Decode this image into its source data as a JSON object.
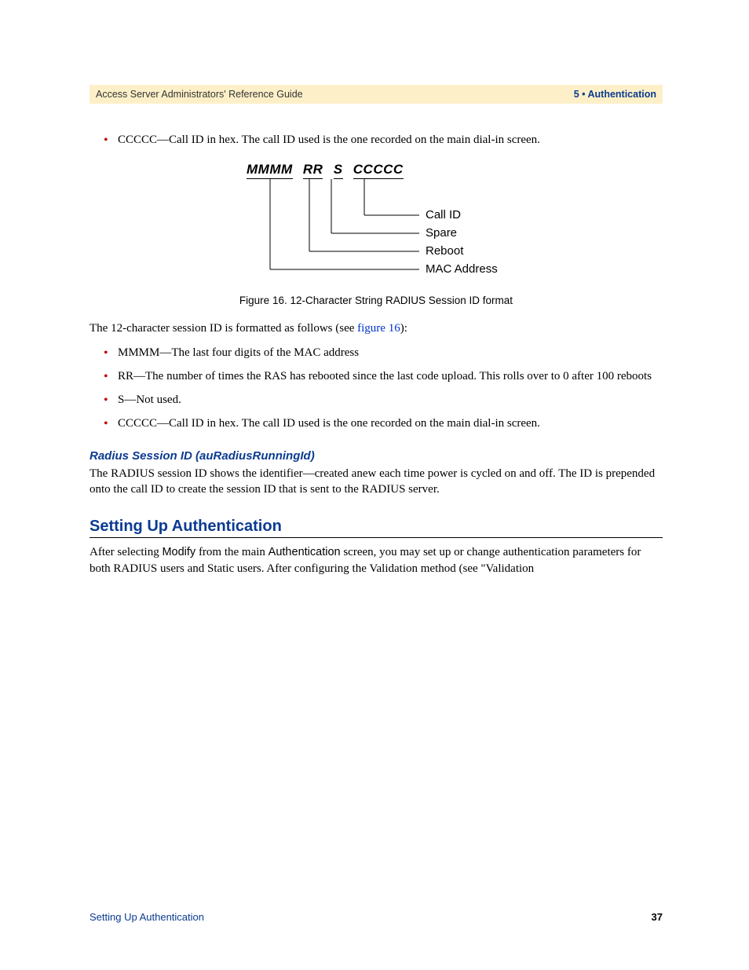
{
  "header": {
    "left": "Access Server Administrators' Reference Guide",
    "right": "5 • Authentication"
  },
  "top_bullet": "CCCCC—Call ID in hex. The call ID used is the one recorded on the main dial-in screen.",
  "diagram": {
    "seg1": "MMMM",
    "seg2": "RR",
    "seg3": "S",
    "seg4": "CCCCC",
    "label1": "Call ID",
    "label2": "Spare",
    "label3": "Reboot",
    "label4": "MAC Address"
  },
  "figure_caption": "Figure 16. 12-Character String RADIUS Session ID format",
  "intro_para_a": "The 12-character session ID is formatted as follows (see ",
  "intro_link": "figure 16",
  "intro_para_b": "):",
  "bullets2": {
    "b1": "MMMM—The last four digits of the MAC address",
    "b2": "RR—The number of times the RAS has rebooted since the last code upload. This rolls over to 0 after 100 reboots",
    "b3": "S—Not used.",
    "b4": "CCCCC—Call ID in hex. The call ID used is the one recorded on the main dial-in screen."
  },
  "h3": "Radius Session ID (auRadiusRunningId)",
  "h3_body": "The RADIUS session ID shows the identifier—created anew each time power is cycled on and off. The ID is prepended onto the call ID to create the session ID that is sent to the RADIUS server.",
  "h2": "Setting Up Authentication",
  "h2_body_a": "After selecting ",
  "h2_body_modify": "Modify",
  "h2_body_b": " from the main ",
  "h2_body_auth": "Authentication",
  "h2_body_c": " screen, you may set up or change authentication parameters for both RADIUS users and Static users. After configuring the Validation method (see \"Validation",
  "footer": {
    "left": "Setting Up Authentication",
    "right": "37"
  }
}
